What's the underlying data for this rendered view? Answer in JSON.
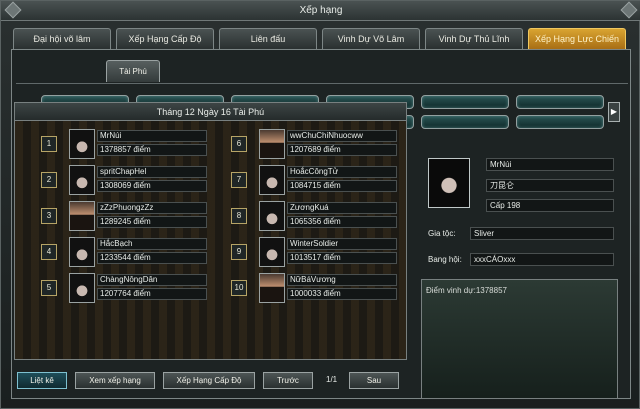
{
  "window": {
    "title": "Xếp hạng"
  },
  "tabs": [
    {
      "label": "Đại hội võ lâm"
    },
    {
      "label": "Xếp Hạng Cấp Độ"
    },
    {
      "label": "Liên đấu"
    },
    {
      "label": "Vinh Dự Võ Lâm"
    },
    {
      "label": "Vinh Dự Thủ Lĩnh"
    },
    {
      "label": "Xếp Hạng Lực Chiến"
    }
  ],
  "subtab": {
    "label": "Tài Phú"
  },
  "ranking": {
    "title": "Tháng 12 Ngày 16 Tài Phú",
    "entries": [
      {
        "rank": "1",
        "name": "MrNúi",
        "points": "1378857 điểm"
      },
      {
        "rank": "2",
        "name": "spritChapHel",
        "points": "1308069 điểm"
      },
      {
        "rank": "3",
        "name": "zZzPhuongzZz",
        "points": "1289245 điểm"
      },
      {
        "rank": "4",
        "name": "HắcBạch",
        "points": "1233544 điểm"
      },
      {
        "rank": "5",
        "name": "ChàngNôngDân",
        "points": "1207764 điểm"
      },
      {
        "rank": "6",
        "name": "wwChuChiNhuocww",
        "points": "1207689 điểm"
      },
      {
        "rank": "7",
        "name": "HoắcCôngTử",
        "points": "1084715 điểm"
      },
      {
        "rank": "8",
        "name": "ZươngKuá",
        "points": "1065356 điểm"
      },
      {
        "rank": "9",
        "name": "WinterSoldier",
        "points": "1013517 điểm"
      },
      {
        "rank": "10",
        "name": "NữBáVương",
        "points": "1000033 điểm"
      }
    ]
  },
  "detail": {
    "name": "MrNúi",
    "nickname": "刀昆仑",
    "level": "Cấp 198",
    "family_label": "Gia tộc:",
    "family_value": "Sliver",
    "gang_label": "Bang hội:",
    "gang_value": "xxxCÁOxxx",
    "honor": "Điểm vinh dự:1378857"
  },
  "buttons": {
    "list": "Liệt kê",
    "view": "Xem xếp hạng",
    "level": "Xếp Hạng Cấp Độ",
    "prev": "Trước",
    "page": "1/1",
    "next": "Sau"
  },
  "arrows": {
    "left": "◀",
    "right": "▶"
  }
}
